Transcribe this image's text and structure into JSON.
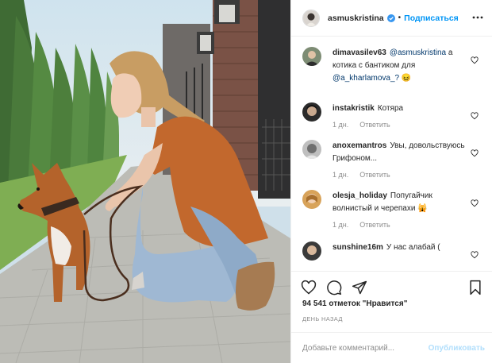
{
  "post": {
    "username": "asmuskristina",
    "follow_label": "Подписаться",
    "separator": "•"
  },
  "comments": [
    {
      "username": "dimavasilev63",
      "mention": "@asmuskristina",
      "text": " а котика с бантиком для ",
      "mention2": "@a_kharlamova_?",
      "emoji": "😖",
      "meta": []
    },
    {
      "username": "instakristik",
      "text": "Котяра",
      "meta": [
        "1 дн.",
        "Ответить"
      ]
    },
    {
      "username": "anoxemantros",
      "text": "Увы, довольствуюсь Грифоном...",
      "meta": [
        "1 дн.",
        "Ответить"
      ]
    },
    {
      "username": "olesja_holiday",
      "text": "Попугайчик волнистый и черепахи",
      "emoji": "🙀",
      "meta": [
        "1 дн.",
        "Ответить"
      ]
    },
    {
      "username": "sunshine16m",
      "text": "У нас алабай (",
      "meta": []
    }
  ],
  "likes": "94 541 отметок \"Нравится\"",
  "time_ago": "ДЕНЬ НАЗАД",
  "add_comment": {
    "placeholder": "Добавьте комментарий...",
    "publish_label": "Опубликовать"
  },
  "colors": {
    "accent": "#0095f6",
    "publish_disabled": "#b2dffc",
    "secondary_text": "#8e8e8e",
    "mention": "#00376b"
  },
  "icons": [
    "more-icon",
    "verified-icon",
    "heart-icon",
    "comment-icon",
    "share-icon",
    "bookmark-icon"
  ]
}
